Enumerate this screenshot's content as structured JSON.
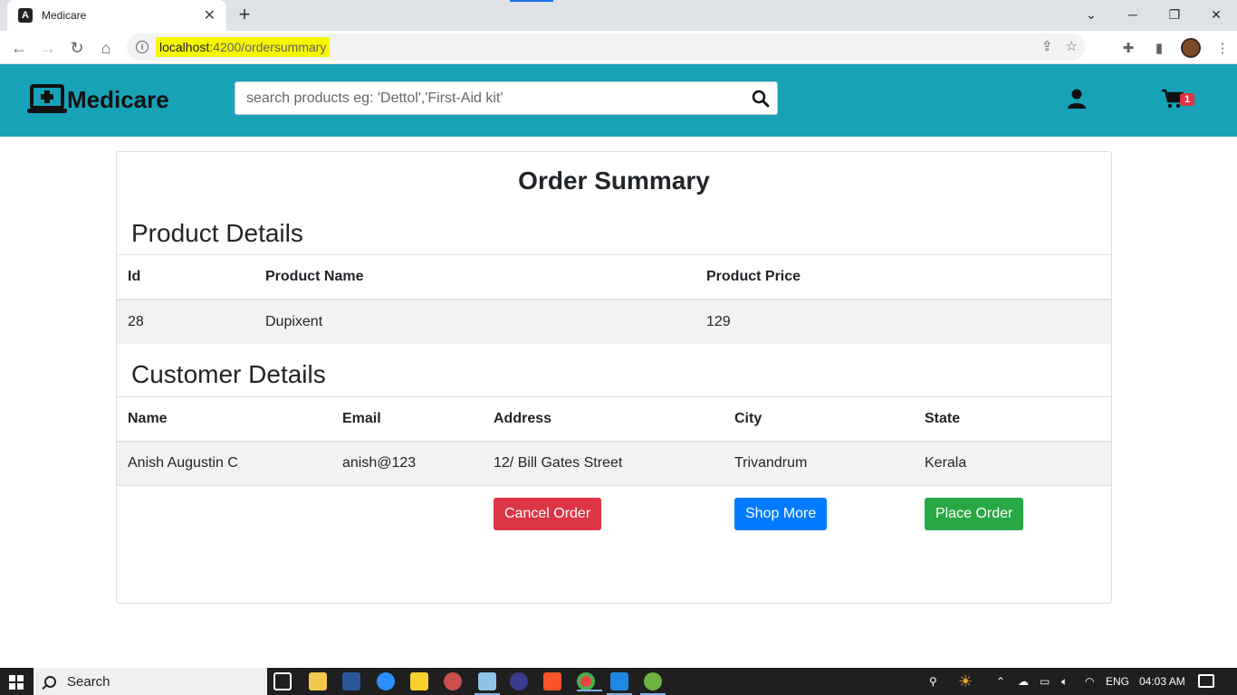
{
  "browser": {
    "tab_title": "Medicare",
    "tab_favicon": "A",
    "url_host": "localhost",
    "url_rest": ":4200/ordersummary"
  },
  "navbar": {
    "brand": "Medicare",
    "search_placeholder": "search products eg: 'Dettol','First-Aid kit'",
    "cart_count": "1"
  },
  "page": {
    "title": "Order Summary",
    "product_section": "Product Details",
    "product_headers": [
      "Id",
      "Product Name",
      "Product Price"
    ],
    "product_row": [
      "28",
      "Dupixent",
      "129"
    ],
    "customer_section": "Customer Details",
    "customer_headers": [
      "Name",
      "Email",
      "Address",
      "City",
      "State"
    ],
    "customer_row": [
      "Anish Augustin C",
      "anish@123",
      "12/ Bill Gates Street",
      "Trivandrum",
      "Kerala"
    ],
    "buttons": {
      "cancel": "Cancel Order",
      "shop_more": "Shop More",
      "place": "Place Order"
    }
  },
  "colors": {
    "navbar": "#17a2b8",
    "danger": "#dc3545",
    "primary": "#007bff",
    "success": "#28a745"
  },
  "taskbar": {
    "search_label": "Search",
    "lang": "ENG",
    "time": "04:03 AM"
  }
}
